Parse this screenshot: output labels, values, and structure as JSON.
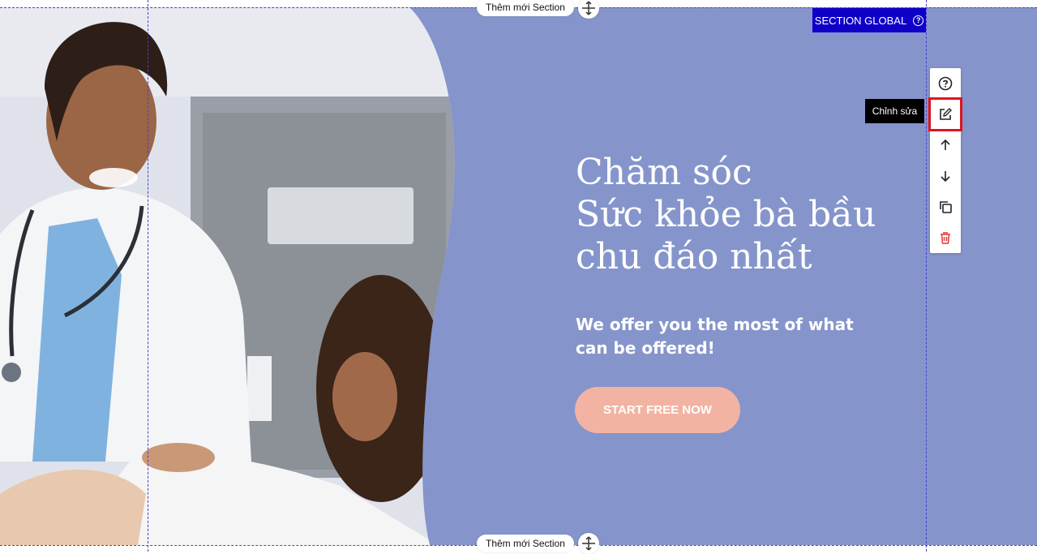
{
  "editor": {
    "add_section_label": "Thêm mới Section",
    "section_global_label": "SECTION GLOBAL",
    "tooltip_text": "Chỉnh sửa",
    "toolbar": {
      "tools": [
        "help-icon",
        "edit-icon",
        "arrow-up-icon",
        "arrow-down-icon",
        "duplicate-icon",
        "trash-icon"
      ]
    }
  },
  "hero": {
    "title_line1": "Chăm sóc",
    "title_line2": "Sức khỏe bà bầu",
    "title_line3": "chu đáo nhất",
    "subtitle": "We offer you the most of what can be offered!",
    "cta_label": "START FREE NOW"
  },
  "colors": {
    "section_bg": "#8595cb",
    "cta_bg": "#f3b3a2",
    "badge_bg": "#0f00c8",
    "highlight": "#e0141e",
    "delete_icon": "#e53935"
  }
}
